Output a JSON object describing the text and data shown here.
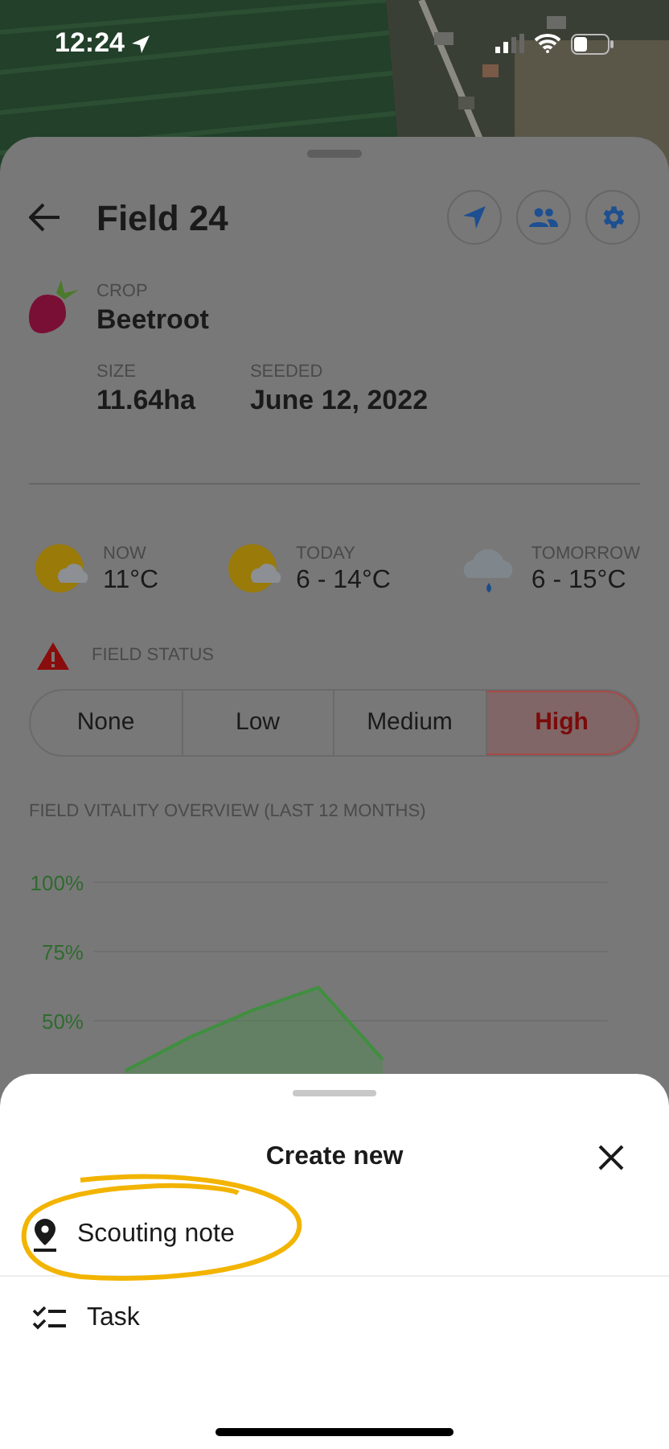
{
  "status_bar": {
    "time": "12:24"
  },
  "field": {
    "title": "Field 24",
    "crop_label": "CROP",
    "crop": "Beetroot",
    "size_label": "SIZE",
    "size": "11.64ha",
    "seeded_label": "SEEDED",
    "seeded": "June 12, 2022"
  },
  "weather": [
    {
      "kind": "partly_cloudy",
      "label": "NOW",
      "value": "11°C"
    },
    {
      "kind": "partly_cloudy",
      "label": "TODAY",
      "value": "6 - 14°C"
    },
    {
      "kind": "rain",
      "label": "TOMORROW",
      "value": "6 - 15°C"
    }
  ],
  "field_status": {
    "label": "FIELD STATUS",
    "options": [
      {
        "label": "None",
        "selected": false
      },
      {
        "label": "Low",
        "selected": false
      },
      {
        "label": "Medium",
        "selected": false
      },
      {
        "label": "High",
        "selected": true
      }
    ]
  },
  "vitality": {
    "title": "FIELD VITALITY OVERVIEW (LAST 12 MONTHS)",
    "chart_data": {
      "type": "area",
      "categories": [
        null,
        null,
        null,
        null,
        null,
        null,
        null,
        null
      ],
      "ylim": [
        0,
        100
      ],
      "yticks": [
        {
          "value": 50,
          "label": "50%"
        },
        {
          "value": 75,
          "label": "75%"
        },
        {
          "value": 100,
          "label": "100%"
        }
      ],
      "series": [
        {
          "color": "#3f8f3f",
          "values": [
            32,
            44,
            54,
            62,
            36,
            null,
            null,
            null
          ]
        }
      ]
    }
  },
  "sheet": {
    "title": "Create new",
    "items": [
      {
        "kind": "scouting",
        "label": "Scouting note",
        "highlighted": true
      },
      {
        "kind": "task",
        "label": "Task",
        "highlighted": false
      }
    ]
  }
}
